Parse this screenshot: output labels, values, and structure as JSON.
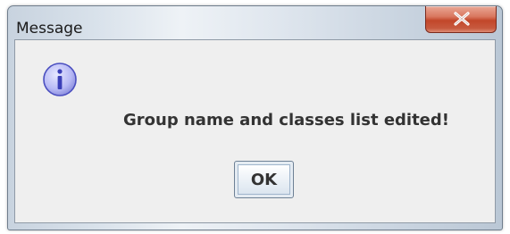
{
  "window": {
    "title": "Message",
    "close_icon": "close-x-icon"
  },
  "dialog": {
    "icon": "info-icon",
    "message": "Group name and classes list edited!",
    "ok_label": "OK"
  },
  "colors": {
    "close_button": "#c2472a",
    "icon_fill": "#b7b9f5",
    "icon_letter": "#3b3fb8"
  }
}
